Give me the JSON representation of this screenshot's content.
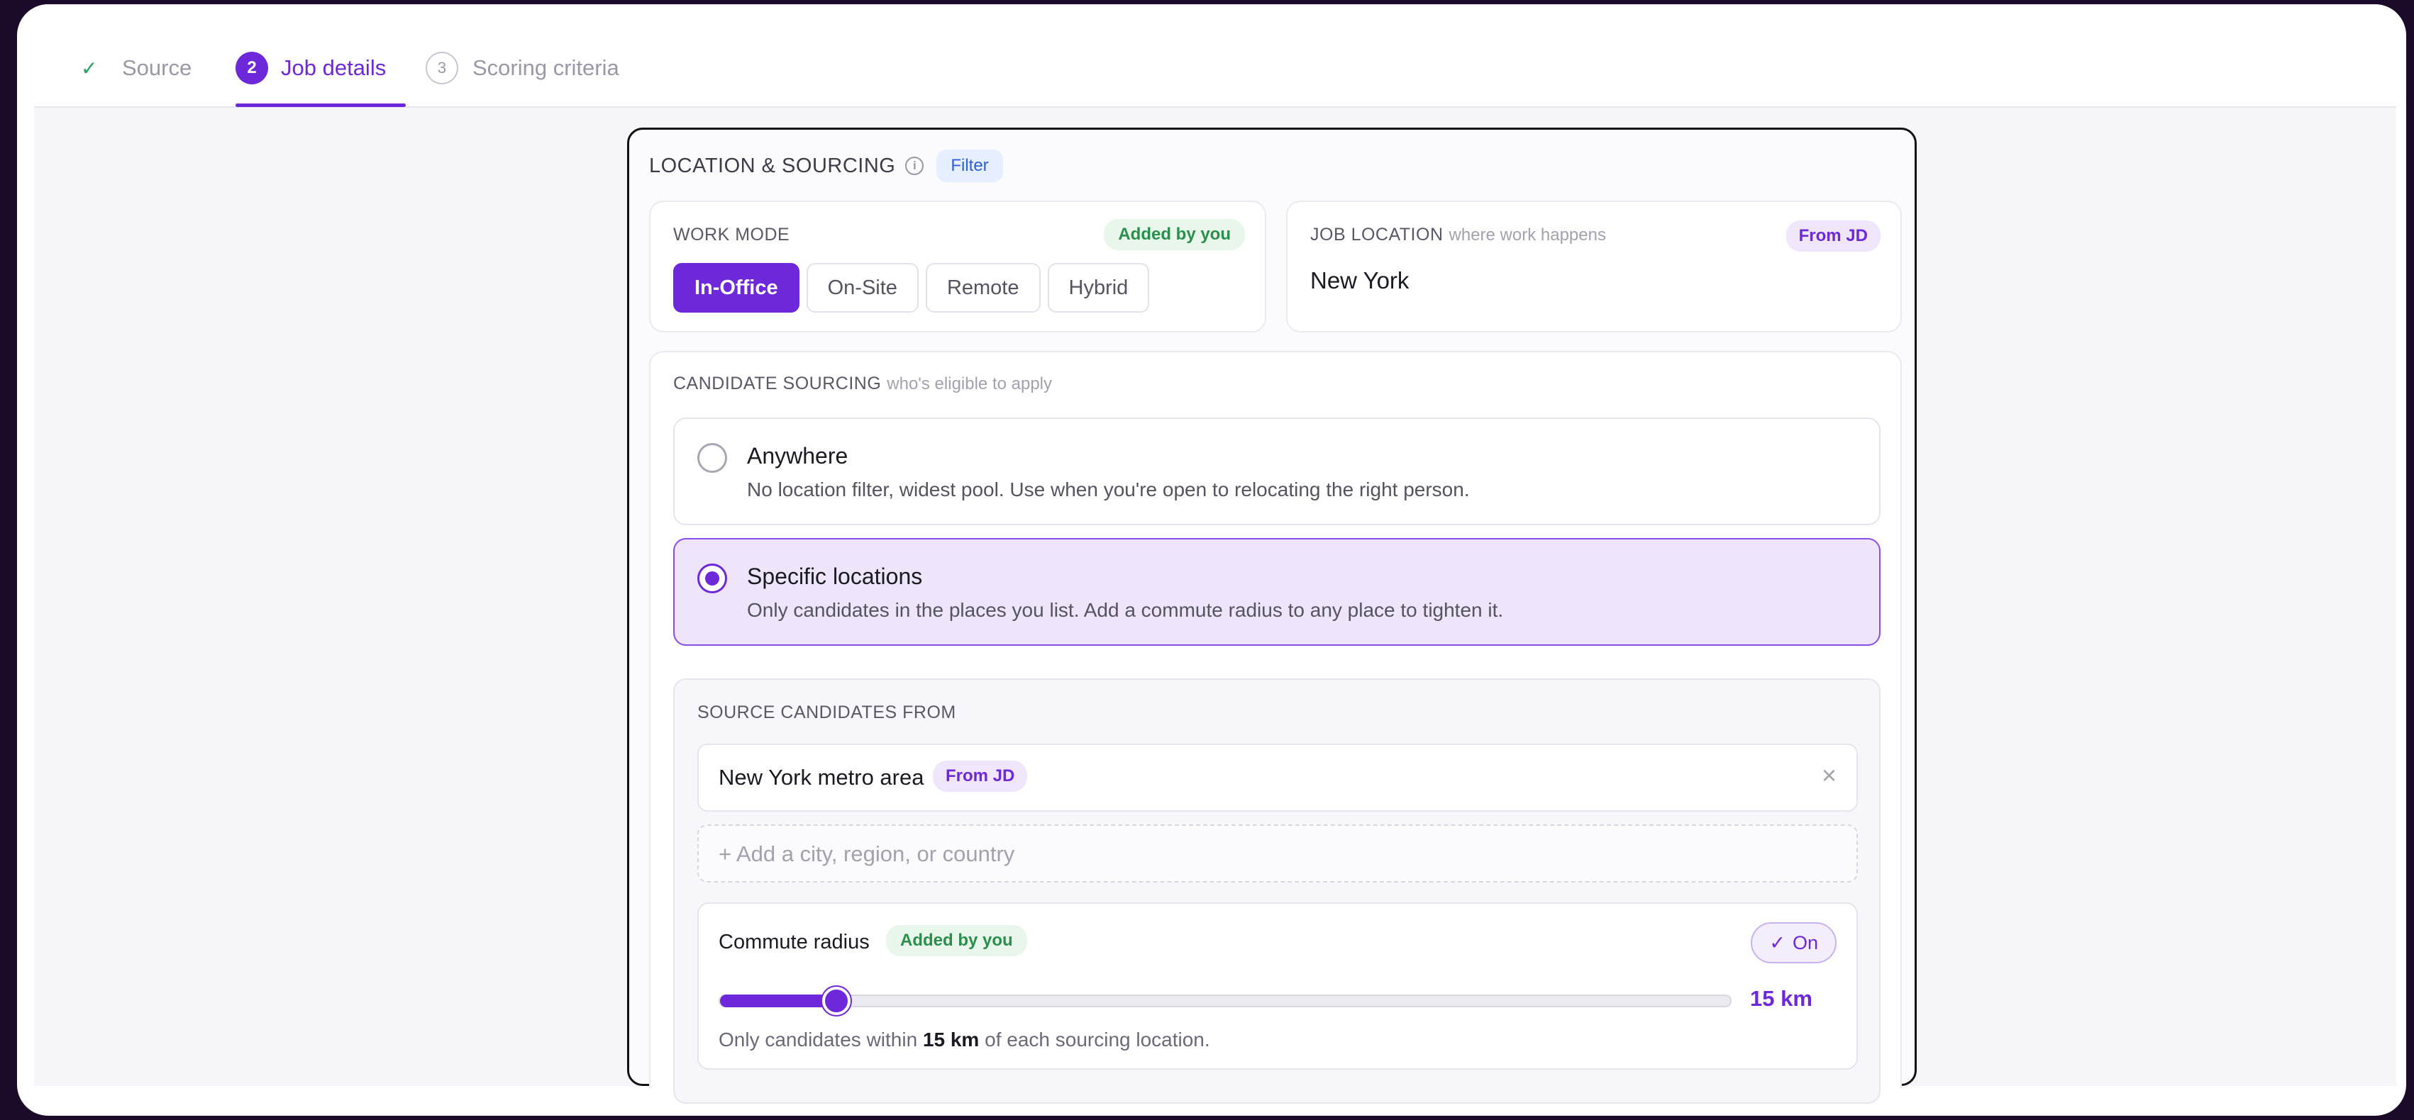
{
  "stepper": {
    "steps": [
      {
        "label": "Source",
        "state": "done"
      },
      {
        "number": "2",
        "label": "Job details",
        "state": "active"
      },
      {
        "number": "3",
        "label": "Scoring criteria",
        "state": "upcoming"
      }
    ]
  },
  "location_sourcing": {
    "title": "LOCATION & SOURCING",
    "filter_badge": "Filter",
    "work_mode": {
      "label": "WORK MODE",
      "badge": "Added by you",
      "options": [
        "In-Office",
        "On-Site",
        "Remote",
        "Hybrid"
      ],
      "selected": "In-Office"
    },
    "job_location": {
      "label": "JOB LOCATION",
      "hint": "where work happens",
      "badge": "From JD",
      "value": "New York"
    },
    "candidate_sourcing": {
      "label": "CANDIDATE SOURCING",
      "hint": "who's eligible to apply",
      "options": [
        {
          "title": "Anywhere",
          "description": "No location filter, widest pool. Use when you're open to relocating the right person.",
          "selected": false
        },
        {
          "title": "Specific locations",
          "description": "Only candidates in the places you list. Add a commute radius to any place to tighten it.",
          "selected": true
        }
      ]
    },
    "source_from": {
      "label": "SOURCE CANDIDATES FROM",
      "locations": [
        {
          "name": "New York metro area",
          "badge": "From JD"
        }
      ],
      "add_placeholder": "+ Add a city, region, or country"
    },
    "commute_radius": {
      "title": "Commute radius",
      "badge": "Added by you",
      "toggle_label": "On",
      "value_label": "15 km",
      "slider_fraction": 0.115,
      "note_prefix": "Only candidates within",
      "note_value": "15 km",
      "note_suffix": "of each sourcing location."
    }
  },
  "colors": {
    "accent": "#6d28d9",
    "success": "#2a8f4b",
    "filter_blue": "#2d5fd6"
  },
  "icons": [
    "check-icon",
    "info-icon",
    "close-icon",
    "checkmark-icon"
  ]
}
